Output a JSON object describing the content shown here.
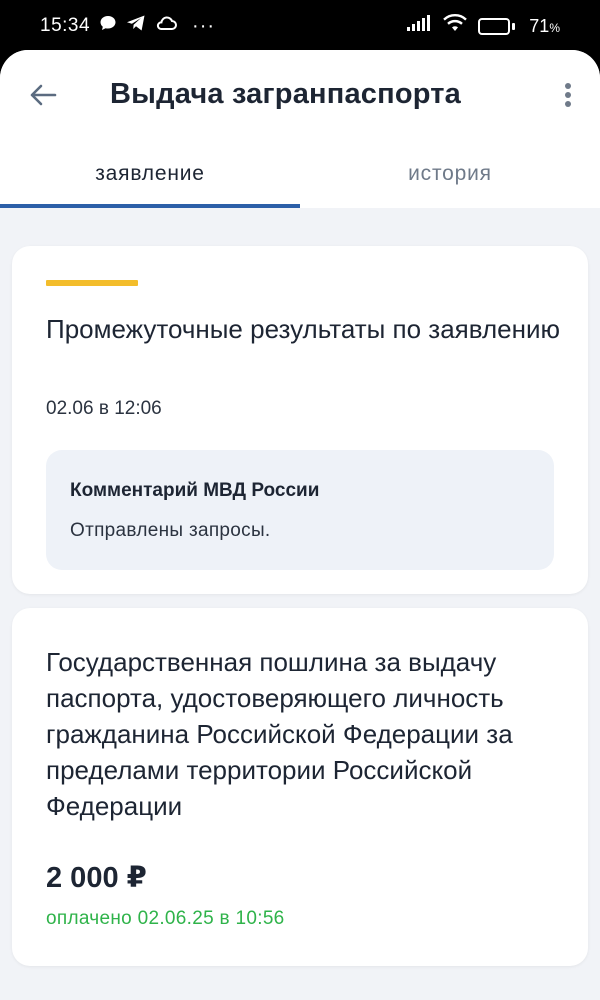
{
  "status_bar": {
    "time": "15:34",
    "more": "···",
    "battery_level": "71",
    "battery_unit": "%",
    "battery_fraction": 0.71
  },
  "header": {
    "title": "Выдача загранпаспорта"
  },
  "tabs": [
    {
      "label": "заявление",
      "active": true
    },
    {
      "label": "история",
      "active": false
    }
  ],
  "result_card": {
    "title": "Промежуточные результаты по заявлению",
    "date": "02.06 в 12:06",
    "comment_title": "Комментарий МВД России",
    "comment_text": "Отправлены запросы."
  },
  "fee_card": {
    "title": "Государственная пошлина за выдачу паспорта, удостоверяющего личность гражданина Российской Федерации за пределами территории Российской Федерации",
    "amount": "2 000 ₽",
    "paid_status": "оплачено 02.06.25 в 10:56"
  },
  "colors": {
    "accent_yellow": "#f3bd2b",
    "tab_underline": "#2c5fa8",
    "paid_green": "#2fb34a",
    "text_dark": "#1d2533",
    "background": "#f1f3f7"
  }
}
